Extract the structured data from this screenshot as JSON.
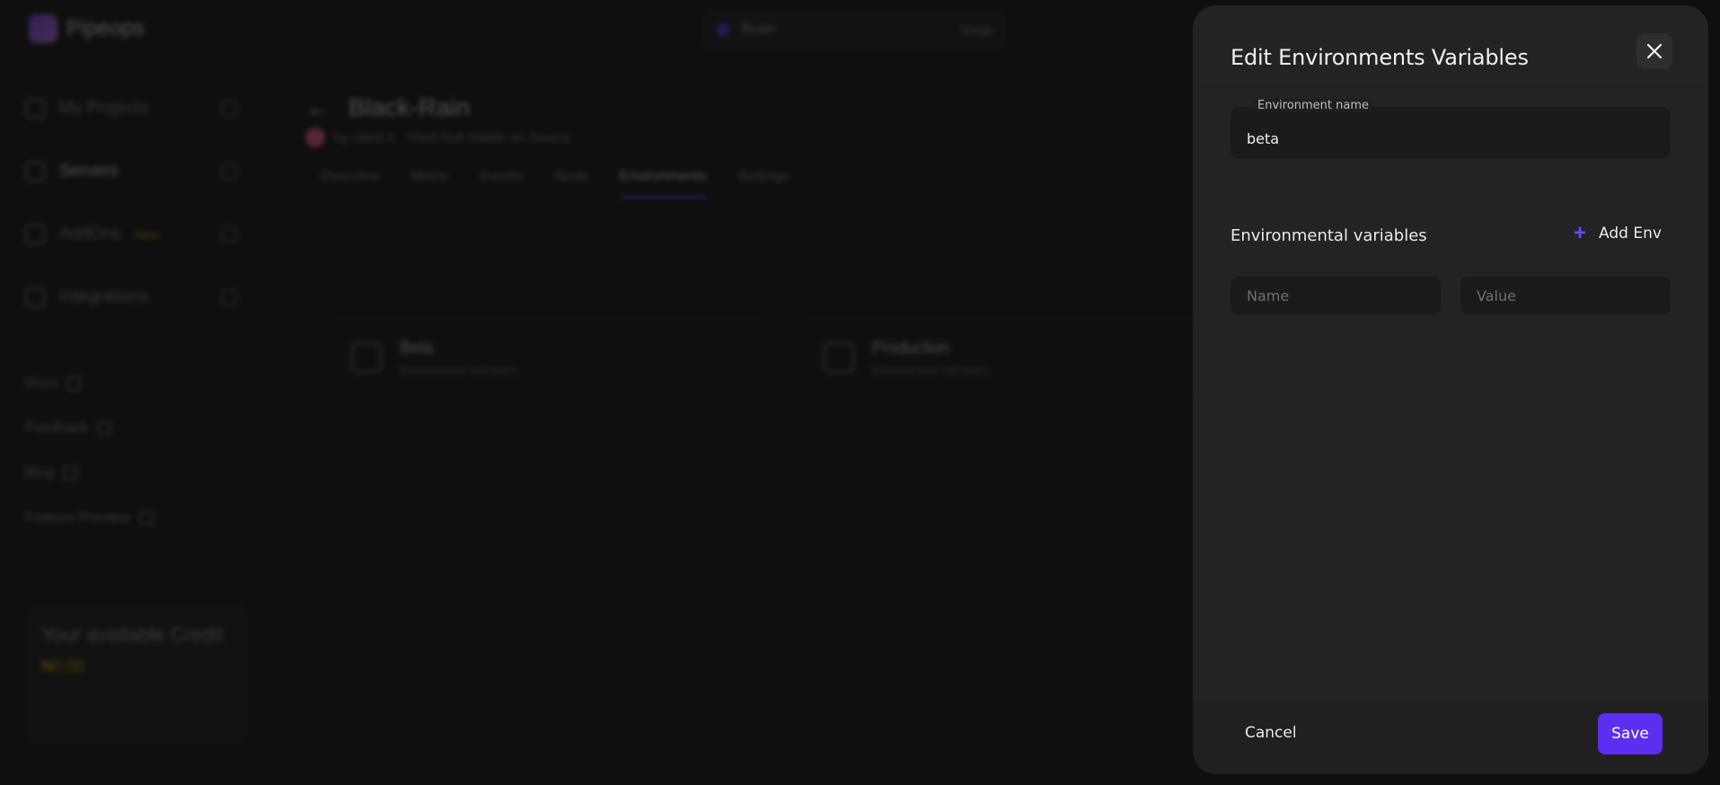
{
  "background": {
    "app_name": "Pipeops",
    "project_select": {
      "name": "Brain",
      "stage": "Stage"
    },
    "sidebar": {
      "items": [
        {
          "label": "My Projects"
        },
        {
          "label": "Servers"
        },
        {
          "label": "AddOns",
          "badge": "New"
        },
        {
          "label": "Integrations"
        }
      ],
      "links": [
        "Docs",
        "Feedback",
        "Blog",
        "Feature Preview"
      ],
      "credit": {
        "title": "Your available Credit",
        "value": "₦0.00"
      }
    },
    "project": {
      "title": "Black-Rain",
      "subtitle": "by rated 3 · Third-Null Stable on Source"
    },
    "tabs": [
      "Overview",
      "Metric",
      "Events",
      "Node",
      "Environments",
      "Settings"
    ],
    "env_cards": [
      {
        "name": "Beta",
        "sub": "Environment Variables"
      },
      {
        "name": "Production",
        "sub": "Environment Variables"
      }
    ]
  },
  "drawer": {
    "title": "Edit Environments Variables",
    "env_name_label": "Environment name",
    "env_name_value": "beta",
    "section_title": "Environmental variables",
    "add_env_label": "Add Env",
    "name_placeholder": "Name",
    "value_placeholder": "Value",
    "cancel_label": "Cancel",
    "save_label": "Save"
  },
  "colors": {
    "accent": "#5b2ff0",
    "plus": "#6a47ff",
    "drawer_bg": "#232323",
    "page_bg": "#141414"
  }
}
